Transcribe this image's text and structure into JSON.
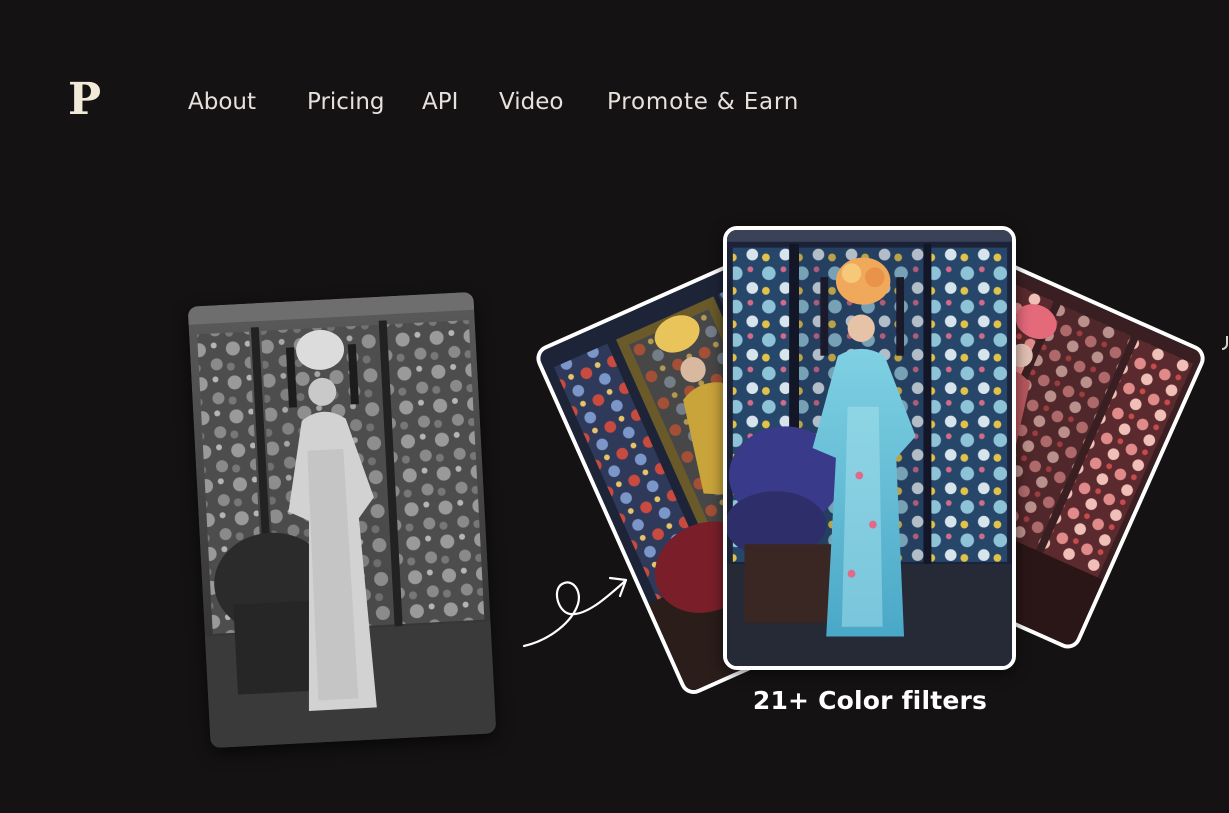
{
  "brand": {
    "logo_letter": "P"
  },
  "nav": {
    "about": "About",
    "pricing": "Pricing",
    "api": "API",
    "video": "Video",
    "promote": "Promote & Earn"
  },
  "hero": {
    "caption": "21+ Color filters"
  },
  "colors": {
    "background": "#141213",
    "card_border": "#ffffff",
    "nav_text": "#e6e1dc",
    "logo": "#f2ead8"
  },
  "icons": {
    "arrow": "curly-arrow-icon"
  }
}
